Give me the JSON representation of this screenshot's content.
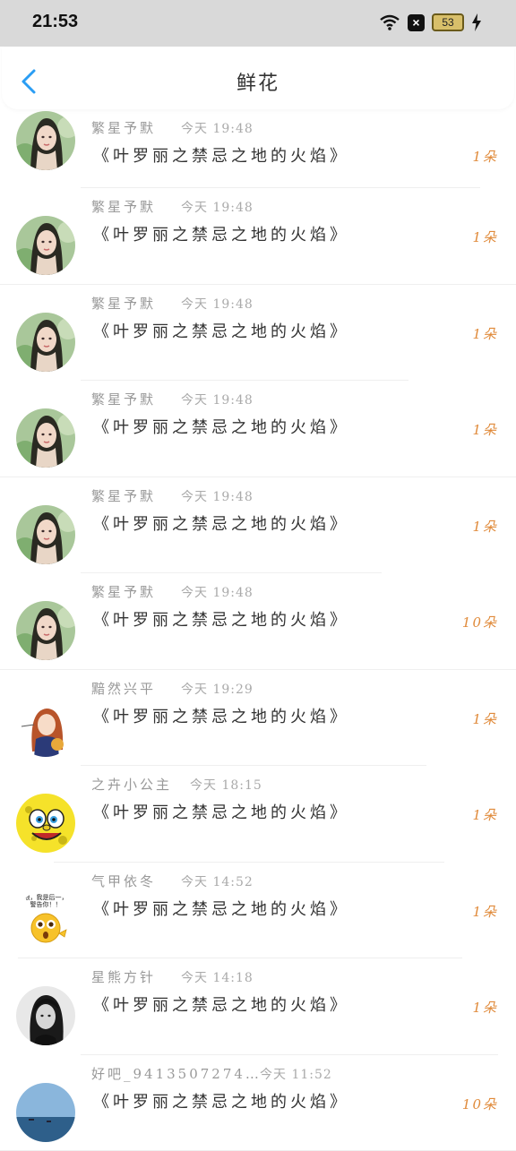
{
  "status": {
    "time": "21:53",
    "battery": "53"
  },
  "header": {
    "title": "鲜花"
  },
  "colors": {
    "accent": "#2a9df4",
    "count": "#e08a3a"
  },
  "items": [
    {
      "user": "繁星予默",
      "time": "今天 19:48",
      "message": "《叶罗丽之禁忌之地的火焰》",
      "count": "1朵",
      "avatar": "girl-portrait"
    },
    {
      "user": "繁星予默",
      "time": "今天 19:48",
      "message": "《叶罗丽之禁忌之地的火焰》",
      "count": "1朵",
      "avatar": "girl-portrait"
    },
    {
      "user": "繁星予默",
      "time": "今天 19:48",
      "message": "《叶罗丽之禁忌之地的火焰》",
      "count": "1朵",
      "avatar": "girl-portrait"
    },
    {
      "user": "繁星予默",
      "time": "今天 19:48",
      "message": "《叶罗丽之禁忌之地的火焰》",
      "count": "1朵",
      "avatar": "girl-portrait"
    },
    {
      "user": "繁星予默",
      "time": "今天 19:48",
      "message": "《叶罗丽之禁忌之地的火焰》",
      "count": "1朵",
      "avatar": "girl-portrait"
    },
    {
      "user": "繁星予默",
      "time": "今天 19:48",
      "message": "《叶罗丽之禁忌之地的火焰》",
      "count": "10朵",
      "avatar": "girl-portrait"
    },
    {
      "user": "黯然兴平",
      "time": "今天 19:29",
      "message": "《叶罗丽之禁忌之地的火焰》",
      "count": "1朵",
      "avatar": "anime-girl"
    },
    {
      "user": "之卉小公主",
      "time": "今天 18:15",
      "message": "《叶罗丽之禁忌之地的火焰》",
      "count": "1朵",
      "avatar": "sponge-face"
    },
    {
      "user": "气甲依冬",
      "time": "今天 14:52",
      "message": "《叶罗丽之禁忌之地的火焰》",
      "count": "1朵",
      "avatar": "emoji-sticker",
      "sticker_text": "喂，我是后一，警告你！！"
    },
    {
      "user": "星熊方针",
      "time": "今天 14:18",
      "message": "《叶罗丽之禁忌之地的火焰》",
      "count": "1朵",
      "avatar": "bw-portrait"
    },
    {
      "user": "好吧_9413507274…",
      "time": "今天 11:52",
      "message": "《叶罗丽之禁忌之地的火焰》",
      "count": "10朵",
      "avatar": "beach"
    }
  ]
}
